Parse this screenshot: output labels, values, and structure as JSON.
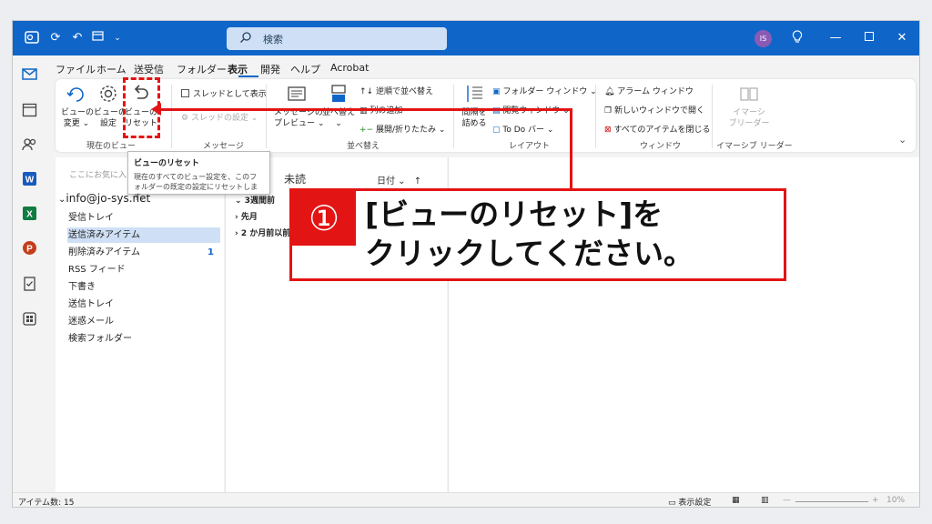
{
  "titlebar": {
    "search_placeholder": "検索",
    "avatar_initials": "IS"
  },
  "menu": [
    "ファイル",
    "ホーム",
    "送受信",
    "フォルダー",
    "表示",
    "開発",
    "ヘルプ",
    "Acrobat"
  ],
  "menu_active": "表示",
  "ribbon": {
    "current_view": {
      "change_view": "ビューの\n変更 ⌄",
      "view_settings": "ビューの\n設定",
      "reset_view": "ビューの\nリセット",
      "group_label": "現在のビュー"
    },
    "messages": {
      "show_as_thread": "スレッドとして表示",
      "thread_settings": "スレッドの設定 ⌄",
      "group_label": "メッセージ"
    },
    "arrangement": {
      "message_preview": "メッセージの\nプレビュー ⌄",
      "sort_by": "並べ替え\n⌄",
      "reverse_sort": "逆順で並べ替え",
      "add_columns": "列の追加",
      "expand_collapse": "展開/折りたたみ ⌄",
      "group_label": "並べ替え"
    },
    "layout": {
      "spacing": "間隔を\n詰める",
      "folder_window": "フォルダー ウィンドウ ⌄",
      "reading_pane": "閲覧ウィンドウ ⌄",
      "todo_bar": "To Do バー ⌄",
      "group_label": "レイアウト"
    },
    "window": {
      "reminders": "アラーム ウィンドウ",
      "new_window": "新しいウィンドウで開く",
      "close_all": "すべてのアイテムを閉じる",
      "group_label": "ウィンドウ"
    },
    "immersive": {
      "reader": "イマーシ\nブリーダー",
      "group_label": "イマーシブ リーダー"
    }
  },
  "tooltip": {
    "title": "ビューのリセット",
    "body": "現在のすべてのビュー設定を、このフォルダーの既定の設定にリセットします。"
  },
  "folder_pane": {
    "favorites_hint": "ここにお気に入り",
    "account": "info@jo-sys.net",
    "folders": [
      {
        "name": "受信トレイ",
        "count": ""
      },
      {
        "name": "送信済みアイテム",
        "count": ""
      },
      {
        "name": "削除済みアイテム",
        "count": "1"
      },
      {
        "name": "RSS フィード",
        "count": ""
      },
      {
        "name": "下書き",
        "count": ""
      },
      {
        "name": "送信トレイ",
        "count": ""
      },
      {
        "name": "迷惑メール",
        "count": ""
      },
      {
        "name": "検索フォルダー",
        "count": ""
      }
    ],
    "selected_index": 1
  },
  "message_list": {
    "filter_unread": "未読",
    "sort_label": "日付 ⌄",
    "groups": [
      "3週間前",
      "先月",
      "2 か月前以前"
    ]
  },
  "status": {
    "items": "アイテム数: 15",
    "view_settings": "表示設定",
    "zoom": "10%"
  },
  "annotation": {
    "number": "①",
    "line1": "[ビューのリセット]を",
    "line2": "クリックしてください。"
  },
  "colors": {
    "titlebar": "#1066c8",
    "highlight": "#e31414",
    "selected_folder": "#cfe0f6"
  }
}
